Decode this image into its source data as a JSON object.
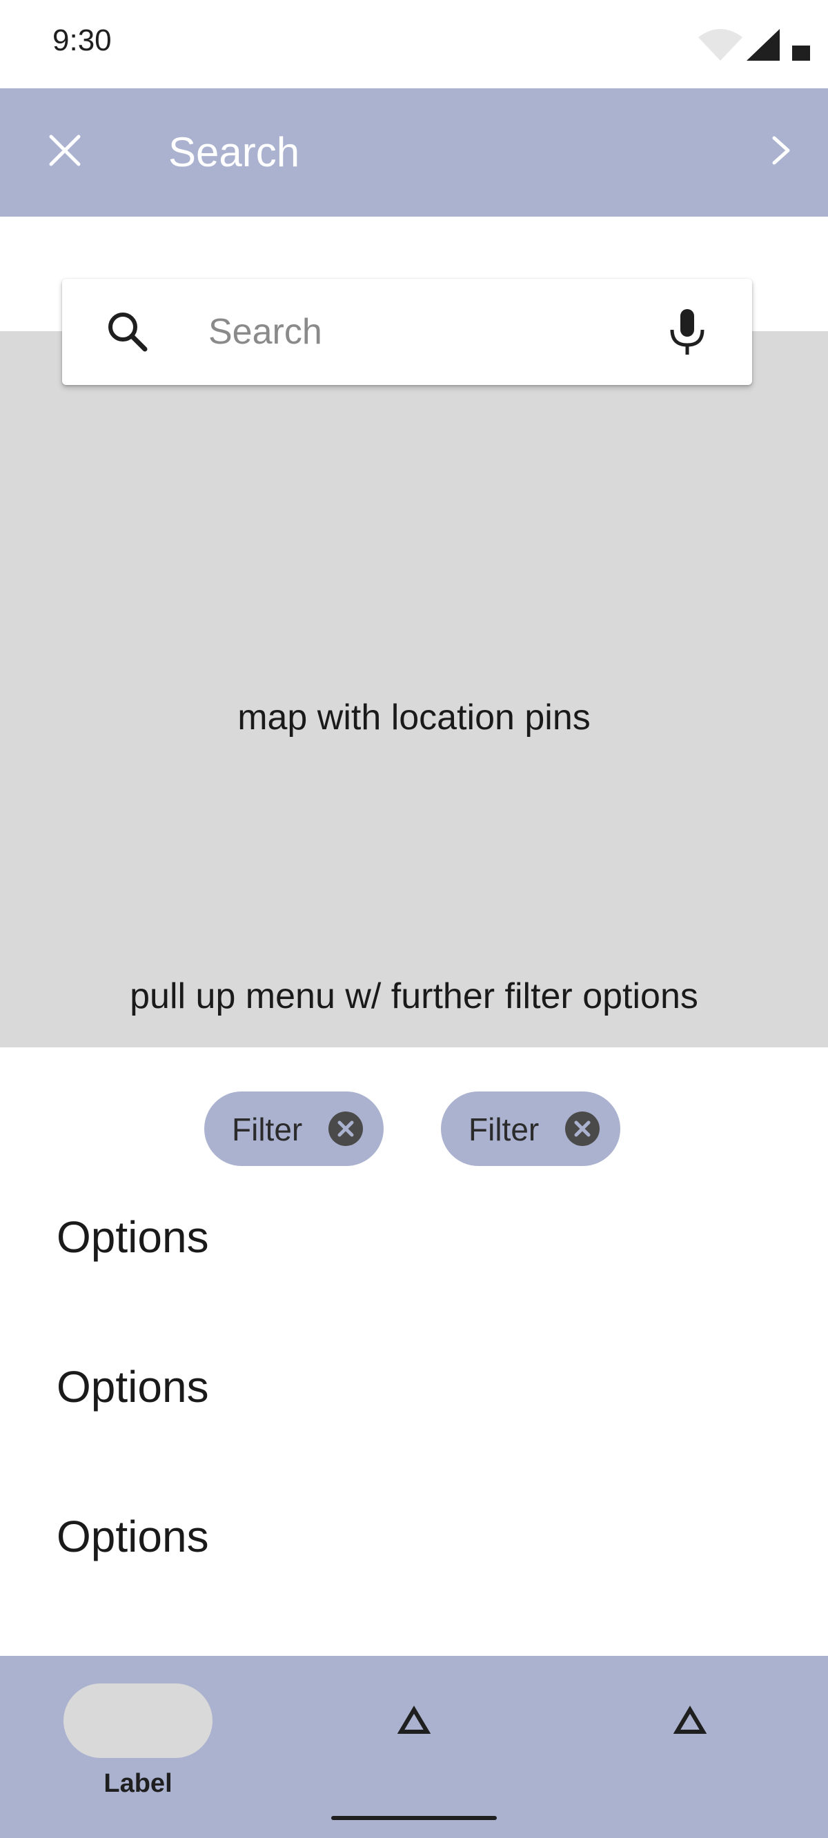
{
  "status_bar": {
    "time": "9:30"
  },
  "app_bar": {
    "title": "Search"
  },
  "search": {
    "placeholder": "Search",
    "value": ""
  },
  "map": {
    "label": "map with location pins",
    "pullup_label": "pull up menu w/ further filter options"
  },
  "filters": [
    {
      "label": "Filter"
    },
    {
      "label": "Filter"
    }
  ],
  "options": [
    {
      "label": "Options"
    },
    {
      "label": "Options"
    },
    {
      "label": "Options"
    }
  ],
  "bottom_nav": {
    "items": [
      {
        "label": "Label",
        "icon": "pill-indicator",
        "active": true
      },
      {
        "label": "",
        "icon": "triangle-icon"
      },
      {
        "label": "",
        "icon": "triangle-icon"
      }
    ]
  },
  "colors": {
    "accent": "#aab2cf",
    "map_background": "#d9d9d9",
    "surface": "#ffffff",
    "chip_icon": "#4a4a4a"
  }
}
